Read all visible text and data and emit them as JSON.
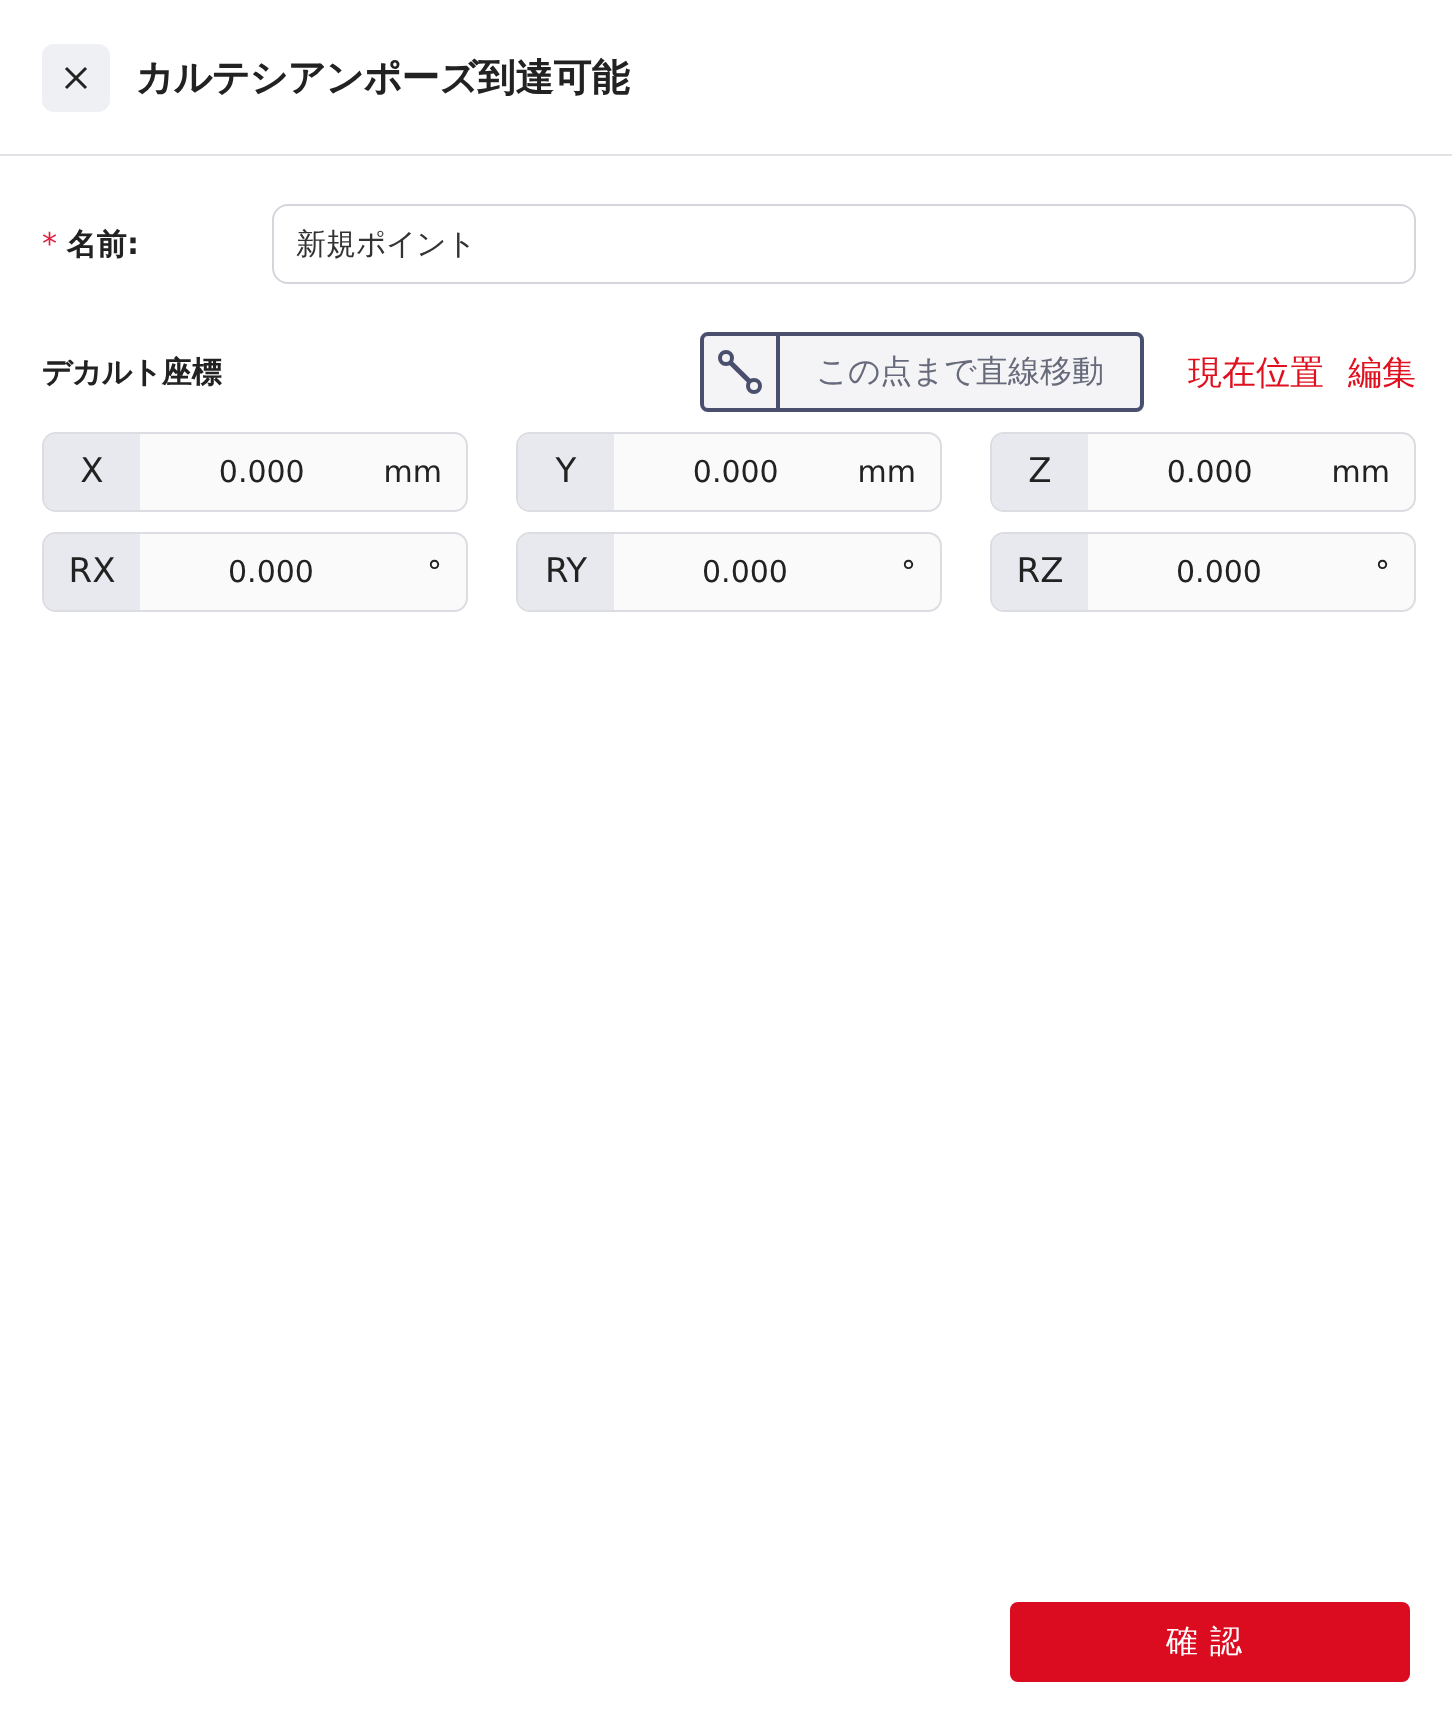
{
  "header": {
    "title": "カルテシアンポーズ到達可能"
  },
  "name_field": {
    "required_mark": "*",
    "label": "名前:",
    "value": "新規ポイント"
  },
  "coordinates": {
    "title": "デカルト座標",
    "move_button": "この点まで直線移動",
    "links": [
      "現在位置",
      "編集"
    ],
    "fields": [
      {
        "axis": "X",
        "value": "0.000",
        "unit": "mm"
      },
      {
        "axis": "Y",
        "value": "0.000",
        "unit": "mm"
      },
      {
        "axis": "Z",
        "value": "0.000",
        "unit": "mm"
      },
      {
        "axis": "RX",
        "value": "0.000",
        "unit": "°"
      },
      {
        "axis": "RY",
        "value": "0.000",
        "unit": "°"
      },
      {
        "axis": "RZ",
        "value": "0.000",
        "unit": "°"
      }
    ]
  },
  "confirm_button": "確認"
}
